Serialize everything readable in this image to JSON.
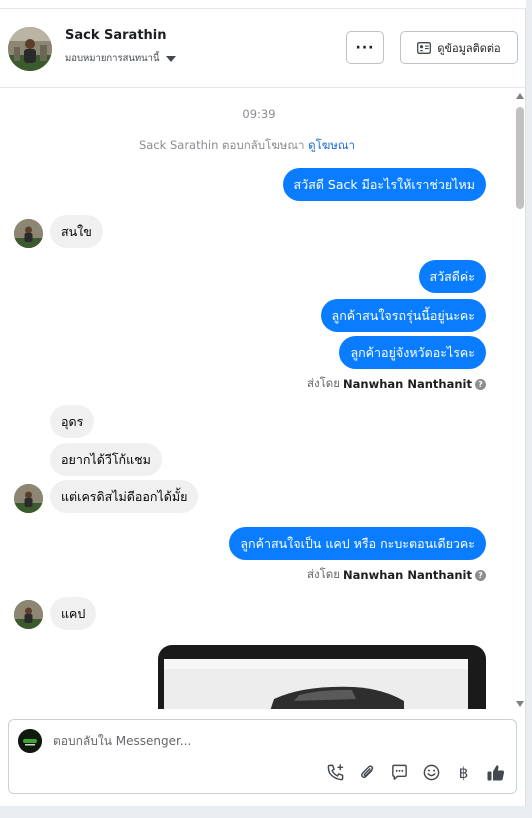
{
  "header": {
    "name": "Sack Sarathin",
    "assignment": "มอบหมายการสนทนานี้",
    "more_label": "···",
    "contact_label": "ดูข้อมูลติดต่อ"
  },
  "chat": {
    "time": "09:39",
    "ad_note": "Sack Sarathin ตอบกลับโฆษณา",
    "ad_link": "ดูโฆษณา",
    "messages": [
      {
        "dir": "out",
        "text": "สวัสดี Sack มีอะไรให้เราช่วยไหม"
      },
      {
        "dir": "in",
        "text": "สนใข"
      },
      {
        "dir": "out",
        "text": "สวัสดีค่ะ"
      },
      {
        "dir": "out",
        "text": "ลูกค้าสนใจรถรุ่นนี้อยู่นะคะ"
      },
      {
        "dir": "out",
        "text": "ลูกค้าอยู่จังหวัดอะไรคะ"
      },
      {
        "dir": "in",
        "text": "อุดร"
      },
      {
        "dir": "in",
        "text": "อยากได้วีโก้แชม"
      },
      {
        "dir": "in",
        "text": "แต่เครดิสไม่ดีออกได้มั้ย"
      },
      {
        "dir": "out",
        "text": "ลูกค้าสนใจเป็น แคป หรือ กะบะตอนเดียวคะ"
      },
      {
        "dir": "in",
        "text": "แคป"
      }
    ],
    "sent_by_prefix": "ส่งโดย",
    "sent_by_name": "Nanwhan Nanthanit",
    "help_glyph": "?"
  },
  "composer": {
    "placeholder": "ตอบกลับใน Messenger...",
    "tools": [
      "phone-add-icon",
      "attach-icon",
      "saved-reply-icon",
      "emoji-icon",
      "baht-icon",
      "like-icon"
    ],
    "baht_glyph": "฿"
  },
  "colors": {
    "outgoing": "#0a7cff",
    "incoming": "#f0f0f0",
    "link": "#1b6fd6"
  }
}
